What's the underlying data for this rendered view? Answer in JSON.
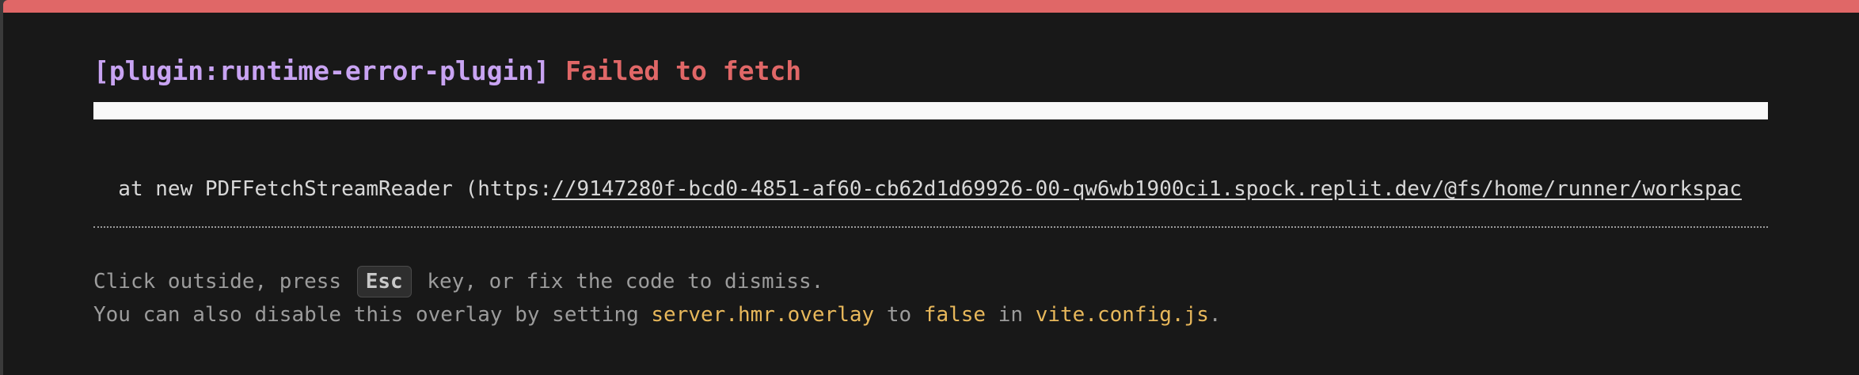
{
  "error": {
    "plugin": "[plugin:runtime-error-plugin]",
    "message": "Failed to fetch"
  },
  "stack": {
    "prefix": "  at new PDFFetchStreamReader (https:",
    "link": "//9147280f-bcd0-4851-af60-cb62d1d69926-00-qw6wb1900ci1.spock.replit.dev/@fs/home/runner/workspac"
  },
  "tip": {
    "line1_before": "Click outside, press ",
    "esc_key": "Esc",
    "line1_after": " key, or fix the code to dismiss.",
    "line2_before": "You can also disable this overlay by setting ",
    "setting": "server.hmr.overlay",
    "line2_mid": " to ",
    "value": "false",
    "line2_in": " in ",
    "config_file": "vite.config.js",
    "line2_end": "."
  },
  "colors": {
    "accent_red": "#e06767",
    "plugin_purple": "#c8a3f2",
    "code_yellow": "#e8b85b",
    "background": "#181818"
  }
}
